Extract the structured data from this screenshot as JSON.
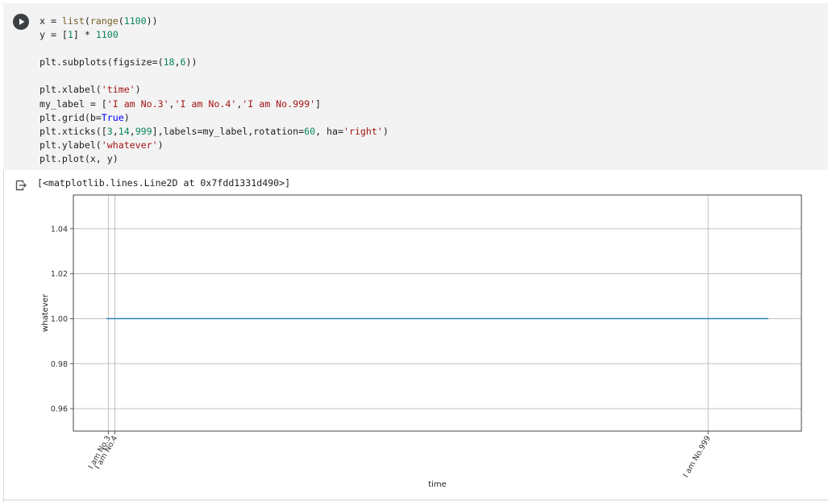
{
  "cell": {
    "run_button": "run-cell",
    "code_lines": [
      [
        {
          "t": "x = "
        },
        {
          "t": "list",
          "c": "tk-bi"
        },
        {
          "t": "("
        },
        {
          "t": "range",
          "c": "tk-bi"
        },
        {
          "t": "("
        },
        {
          "t": "1100",
          "c": "tk-num"
        },
        {
          "t": "))"
        }
      ],
      [
        {
          "t": "y = ["
        },
        {
          "t": "1",
          "c": "tk-num"
        },
        {
          "t": "] * "
        },
        {
          "t": "1100",
          "c": "tk-num"
        }
      ],
      [],
      [
        {
          "t": "plt.subplots(figsize=("
        },
        {
          "t": "18",
          "c": "tk-num"
        },
        {
          "t": ","
        },
        {
          "t": "6",
          "c": "tk-num"
        },
        {
          "t": "))"
        }
      ],
      [],
      [
        {
          "t": "plt.xlabel("
        },
        {
          "t": "'time'",
          "c": "tk-str"
        },
        {
          "t": ")"
        }
      ],
      [
        {
          "t": "my_label = ["
        },
        {
          "t": "'I am No.3'",
          "c": "tk-str"
        },
        {
          "t": ","
        },
        {
          "t": "'I am No.4'",
          "c": "tk-str"
        },
        {
          "t": ","
        },
        {
          "t": "'I am No.999'",
          "c": "tk-str"
        },
        {
          "t": "]"
        }
      ],
      [
        {
          "t": "plt.grid(b="
        },
        {
          "t": "True",
          "c": "tk-kw"
        },
        {
          "t": ")"
        }
      ],
      [
        {
          "t": "plt.xticks(["
        },
        {
          "t": "3",
          "c": "tk-num"
        },
        {
          "t": ","
        },
        {
          "t": "14",
          "c": "tk-num"
        },
        {
          "t": ","
        },
        {
          "t": "999",
          "c": "tk-num"
        },
        {
          "t": "],labels=my_label,rotation="
        },
        {
          "t": "60",
          "c": "tk-num"
        },
        {
          "t": ", ha="
        },
        {
          "t": "'right'",
          "c": "tk-str"
        },
        {
          "t": ")"
        }
      ],
      [
        {
          "t": "plt.ylabel("
        },
        {
          "t": "'whatever'",
          "c": "tk-str"
        },
        {
          "t": ")"
        }
      ],
      [
        {
          "t": "plt.plot(x, y)"
        }
      ]
    ]
  },
  "output": {
    "icon": "output-redirect-icon",
    "text": "[<matplotlib.lines.Line2D at 0x7fdd1331d490>]"
  },
  "colors": {
    "code_bg": "#f3f3f3",
    "line": "#1f77b4",
    "grid": "#b0b0b0"
  },
  "chart_data": {
    "type": "line",
    "title": "",
    "xlabel": "time",
    "ylabel": "whatever",
    "x_range": [
      -55,
      1154
    ],
    "ylim": [
      0.95,
      1.055
    ],
    "yticks": [
      0.96,
      0.98,
      1.0,
      1.02,
      1.04
    ],
    "ytick_labels": [
      "0.96",
      "0.98",
      "1.00",
      "1.02",
      "1.04"
    ],
    "xticks": [
      3,
      14,
      999
    ],
    "xtick_labels": [
      "I am No.3",
      "I am No.4",
      "I am No.999"
    ],
    "xtick_rotation": 60,
    "grid": true,
    "series": [
      {
        "x_start": 0,
        "x_end": 1099,
        "y": 1
      }
    ]
  }
}
